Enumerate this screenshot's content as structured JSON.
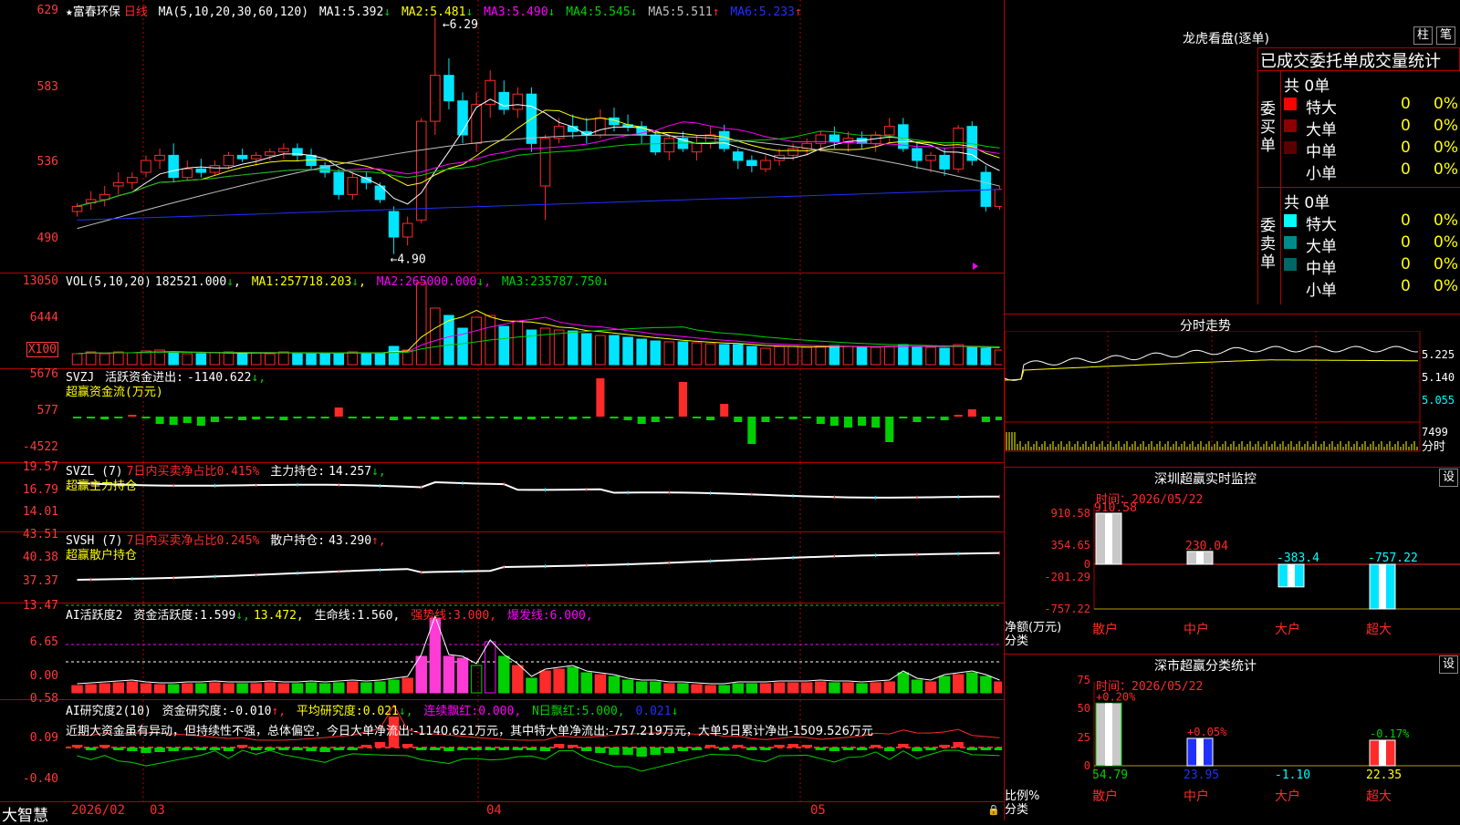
{
  "colors": {
    "up": "#ff2a2a",
    "down": "#00e5ff",
    "grid": "#b00000",
    "yellow": "#ffff00",
    "magenta": "#ff00ff",
    "green": "#00d000",
    "white": "#ffffff",
    "blue": "#2030ff",
    "gray": "#c0c0c0"
  },
  "main": {
    "stock_name": "★富春环保",
    "period": "日线",
    "ma_label": "MA(5,10,20,30,60,120)",
    "ma": [
      {
        "label": "MA1:",
        "value": "5.392",
        "arrow": "↓"
      },
      {
        "label": "MA2:",
        "value": "5.481",
        "arrow": "↓"
      },
      {
        "label": "MA3:",
        "value": "5.490",
        "arrow": "↓"
      },
      {
        "label": "MA4:",
        "value": "5.545",
        "arrow": "↓"
      },
      {
        "label": "MA5:",
        "value": "5.511",
        "arrow": "↑"
      },
      {
        "label": "MA6:",
        "value": "5.233",
        "arrow": "↑"
      }
    ],
    "ticks": [
      "629",
      "583",
      "536",
      "490"
    ],
    "high_label": "6.29",
    "low_label": "4.90"
  },
  "vol": {
    "header": "VOL(5,10,20)",
    "value": "182521.000",
    "arrow": "↓",
    "ma": [
      {
        "label": "MA1:",
        "value": "257718.203",
        "arrow": "↓"
      },
      {
        "label": "MA2:",
        "value": "265000.000",
        "arrow": "↓"
      },
      {
        "label": "MA3:",
        "value": "235787.750",
        "arrow": "↓"
      }
    ],
    "ticks": [
      "13050",
      "6444"
    ],
    "unit": "X100"
  },
  "svzj": {
    "header": "SVZJ",
    "label": "活跃资金进出:",
    "value": "-1140.622",
    "arrow": "↓,",
    "title2": "超赢资金流(万元)",
    "ticks": [
      "5676",
      "577",
      "-4522"
    ]
  },
  "svzl": {
    "header": "SVZL (7)",
    "label1": "7日内买卖净占比0.415%",
    "label2": "主力持仓:",
    "value": "14.257",
    "arrow": "↓,",
    "title2": "超赢主力持仓",
    "ticks": [
      "19.57",
      "16.79",
      "14.01"
    ]
  },
  "svsh": {
    "header": "SVSH (7)",
    "label1": "7日内买卖净占比0.245%",
    "label2": "散户持仓:",
    "value": "43.290",
    "arrow": "↑,",
    "title2": "超赢散户持仓",
    "ticks": [
      "43.51",
      "40.38",
      "37.37"
    ]
  },
  "ai1": {
    "header": "AI活跃度2",
    "l1": "资金活跃度:",
    "v1": "1.599",
    "a1": "↓,",
    "v2": "13.472,",
    "l3": "生命线:",
    "v3": "1.560,",
    "l4": "强势线:",
    "v4": "3.000,",
    "l5": "爆发线:",
    "v5": "6.000,",
    "ticks": [
      "13.47",
      "6.65",
      "0.00"
    ]
  },
  "ai2": {
    "header": "AI研究度2(10)",
    "l1": "资金研究度:",
    "v1": "-0.010",
    "a1": "↑,",
    "l2": "平均研究度:",
    "v2": "0.021",
    "a2": "↓,",
    "l3": "连续飘红:",
    "v3": "0.000,",
    "l4": "N日飘红:",
    "v4": "5.000,",
    "v5": "0.021",
    "a5": "↓",
    "comment": "近期大资金虽有异动，但持续性不强，总体偏空，今日大单净流出:-1140.621万元，其中特大单净流出:-757.219万元，大单5日累计净出-1509.526万元",
    "ticks": [
      "0.58",
      "0.09",
      "-0.40"
    ]
  },
  "xaxis": {
    "brand": "大智慧",
    "labels": [
      "2026/02",
      "03",
      "04",
      "05"
    ]
  },
  "right": {
    "lhb_title": "龙虎看盘(逐单)",
    "btn1": "柱",
    "btn2": "笔",
    "stat_title": "已成交委托单成交量统计",
    "buy": {
      "side": "委买单",
      "total": "共 0单",
      "rows": [
        {
          "name": "特大",
          "v": "0",
          "p": "0%",
          "c": "#ff0000"
        },
        {
          "name": "大单",
          "v": "0",
          "p": "0%",
          "c": "#8b0000"
        },
        {
          "name": "中单",
          "v": "0",
          "p": "0%",
          "c": "#5a0000"
        },
        {
          "name": "小单",
          "v": "0",
          "p": "0%",
          "c": "#000000"
        }
      ]
    },
    "sell": {
      "side": "委卖单",
      "total": "共 0单",
      "rows": [
        {
          "name": "特大",
          "v": "0",
          "p": "0%",
          "c": "#00ffff"
        },
        {
          "name": "大单",
          "v": "0",
          "p": "0%",
          "c": "#008b8b"
        },
        {
          "name": "中单",
          "v": "0",
          "p": "0%",
          "c": "#006666"
        },
        {
          "name": "小单",
          "v": "0",
          "p": "0%",
          "c": "#000000"
        }
      ]
    },
    "fs_title": "分时走势",
    "fs_ticks": [
      "5.225",
      "5.140",
      "5.055"
    ],
    "fs_vol": "7499",
    "fs_vol_label": "分时",
    "sz_title": "深圳超赢实时监控",
    "sz_btn": "设",
    "sz_time": "时间：2026/05/22",
    "sz_ticks": [
      "910.58",
      "354.65",
      "0",
      "-201.29",
      "-757.22"
    ],
    "sz_ylabel1": "净额(万元)",
    "sz_ylabel2": "分类",
    "sz_vals": [
      "910.58",
      "230.04",
      "-383.4",
      "-757.22"
    ],
    "cats": [
      "散户",
      "中户",
      "大户",
      "超大"
    ],
    "ss_title": "深市超赢分类统计",
    "ss_btn": "设",
    "ss_time": "时间：2026/05/22",
    "ss_ticks": [
      "75",
      "50",
      "25",
      "0"
    ],
    "ss_pcts": [
      "+0.20%",
      "+0.05%",
      "",
      "-0.17%"
    ],
    "ss_vals": [
      "54.79",
      "23.95",
      "-1.10",
      "22.35"
    ],
    "ss_ylabel1": "比例%",
    "ss_ylabel2": "分类"
  },
  "chart_data": [
    {
      "type": "candlestick",
      "title": "富春环保 日线",
      "ylim": [
        4.85,
        6.35
      ],
      "ohlc": [
        [
          5.15,
          5.2,
          5.12,
          5.18
        ],
        [
          5.2,
          5.27,
          5.16,
          5.22
        ],
        [
          5.22,
          5.3,
          5.18,
          5.25
        ],
        [
          5.3,
          5.38,
          5.25,
          5.32
        ],
        [
          5.32,
          5.38,
          5.28,
          5.35
        ],
        [
          5.38,
          5.48,
          5.35,
          5.45
        ],
        [
          5.45,
          5.52,
          5.4,
          5.48
        ],
        [
          5.48,
          5.55,
          5.32,
          5.35
        ],
        [
          5.35,
          5.45,
          5.33,
          5.4
        ],
        [
          5.4,
          5.46,
          5.35,
          5.38
        ],
        [
          5.38,
          5.45,
          5.36,
          5.42
        ],
        [
          5.42,
          5.5,
          5.4,
          5.48
        ],
        [
          5.48,
          5.52,
          5.44,
          5.46
        ],
        [
          5.46,
          5.5,
          5.42,
          5.48
        ],
        [
          5.48,
          5.52,
          5.45,
          5.5
        ],
        [
          5.5,
          5.55,
          5.46,
          5.52
        ],
        [
          5.52,
          5.55,
          5.45,
          5.48
        ],
        [
          5.48,
          5.52,
          5.4,
          5.42
        ],
        [
          5.42,
          5.44,
          5.35,
          5.38
        ],
        [
          5.38,
          5.4,
          5.22,
          5.25
        ],
        [
          5.25,
          5.38,
          5.22,
          5.35
        ],
        [
          5.35,
          5.38,
          5.28,
          5.32
        ],
        [
          5.3,
          5.32,
          5.2,
          5.22
        ],
        [
          5.15,
          5.18,
          4.9,
          5.0
        ],
        [
          5.0,
          5.12,
          4.95,
          5.08
        ],
        [
          5.1,
          5.7,
          5.08,
          5.68
        ],
        [
          5.68,
          6.29,
          5.6,
          5.95
        ],
        [
          5.95,
          6.05,
          5.75,
          5.8
        ],
        [
          5.8,
          5.85,
          5.55,
          5.6
        ],
        [
          5.55,
          5.85,
          5.5,
          5.78
        ],
        [
          5.78,
          5.98,
          5.7,
          5.92
        ],
        [
          5.85,
          5.92,
          5.72,
          5.75
        ],
        [
          5.75,
          5.88,
          5.7,
          5.84
        ],
        [
          5.84,
          5.88,
          5.5,
          5.55
        ],
        [
          5.3,
          5.6,
          5.1,
          5.58
        ],
        [
          5.58,
          5.7,
          5.55,
          5.65
        ],
        [
          5.65,
          5.72,
          5.58,
          5.62
        ],
        [
          5.62,
          5.7,
          5.55,
          5.6
        ],
        [
          5.6,
          5.75,
          5.58,
          5.7
        ],
        [
          5.7,
          5.76,
          5.62,
          5.66
        ],
        [
          5.66,
          5.72,
          5.62,
          5.65
        ],
        [
          5.65,
          5.68,
          5.55,
          5.6
        ],
        [
          5.6,
          5.62,
          5.48,
          5.5
        ],
        [
          5.5,
          5.6,
          5.45,
          5.58
        ],
        [
          5.58,
          5.62,
          5.5,
          5.52
        ],
        [
          5.5,
          5.6,
          5.45,
          5.55
        ],
        [
          5.55,
          5.65,
          5.52,
          5.6
        ],
        [
          5.62,
          5.66,
          5.5,
          5.52
        ],
        [
          5.5,
          5.52,
          5.4,
          5.45
        ],
        [
          5.45,
          5.48,
          5.38,
          5.42
        ],
        [
          5.4,
          5.48,
          5.38,
          5.45
        ],
        [
          5.45,
          5.52,
          5.42,
          5.48
        ],
        [
          5.48,
          5.55,
          5.45,
          5.52
        ],
        [
          5.52,
          5.58,
          5.48,
          5.55
        ],
        [
          5.55,
          5.62,
          5.5,
          5.6
        ],
        [
          5.6,
          5.65,
          5.52,
          5.56
        ],
        [
          5.56,
          5.62,
          5.5,
          5.58
        ],
        [
          5.58,
          5.62,
          5.52,
          5.55
        ],
        [
          5.55,
          5.62,
          5.5,
          5.6
        ],
        [
          5.6,
          5.7,
          5.55,
          5.65
        ],
        [
          5.66,
          5.7,
          5.5,
          5.52
        ],
        [
          5.52,
          5.56,
          5.4,
          5.45
        ],
        [
          5.45,
          5.5,
          5.38,
          5.48
        ],
        [
          5.48,
          5.52,
          5.36,
          5.4
        ],
        [
          5.4,
          5.66,
          5.38,
          5.64
        ],
        [
          5.65,
          5.68,
          5.42,
          5.45
        ],
        [
          5.38,
          5.42,
          5.15,
          5.18
        ],
        [
          5.18,
          5.3,
          5.16,
          5.28
        ]
      ]
    }
  ]
}
